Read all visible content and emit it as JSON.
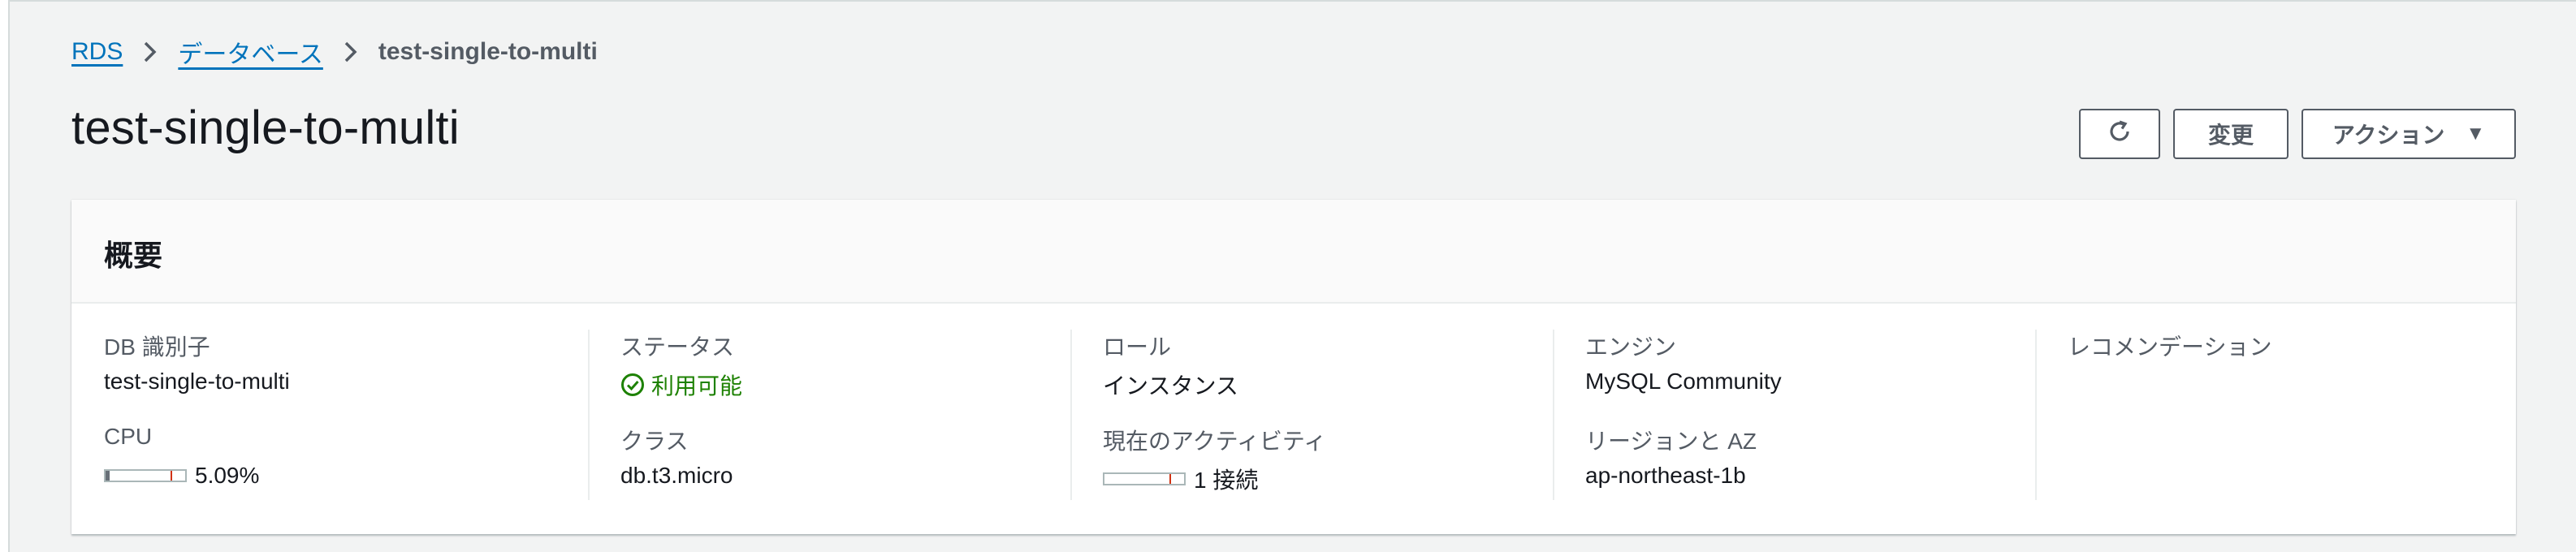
{
  "breadcrumb": {
    "items": [
      "RDS",
      "データベース"
    ],
    "current": "test-single-to-multi"
  },
  "page": {
    "title": "test-single-to-multi"
  },
  "actions": {
    "refresh_icon": "refresh-icon",
    "modify_label": "変更",
    "actions_label": "アクション",
    "actions_caret": "▼"
  },
  "summary": {
    "title": "概要",
    "db_identifier": {
      "label": "DB 識別子",
      "value": "test-single-to-multi"
    },
    "cpu": {
      "label": "CPU",
      "value": "5.09%",
      "fraction": 0.0509
    },
    "status": {
      "label": "ステータス",
      "value": "利用可能",
      "color": "#1d8102"
    },
    "class": {
      "label": "クラス",
      "value": "db.t3.micro"
    },
    "role": {
      "label": "ロール",
      "value": "インスタンス"
    },
    "activity": {
      "label": "現在のアクティビティ",
      "value": "1 接続",
      "fraction": 0.0
    },
    "engine": {
      "label": "エンジン",
      "value": "MySQL Community"
    },
    "region": {
      "label": "リージョンと AZ",
      "value": "ap-northeast-1b"
    },
    "recommendation": {
      "label": "レコメンデーション"
    }
  },
  "colors": {
    "link": "#0073bb",
    "background": "#f2f3f3",
    "meter_mark": "#d13212"
  }
}
